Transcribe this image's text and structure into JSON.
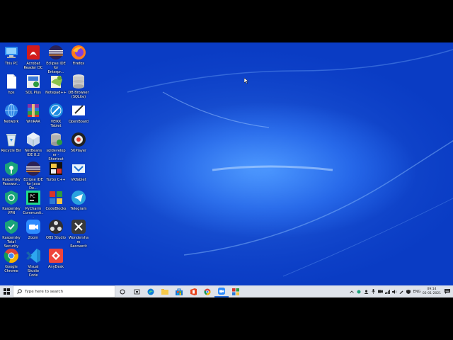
{
  "desktop": {
    "icons": [
      {
        "label": "This PC",
        "icon": "computer-icon"
      },
      {
        "label": "Acrobat Reader DC",
        "icon": "acrobat-icon"
      },
      {
        "label": "Eclipse IDE for Enterpr...",
        "icon": "eclipse-icon"
      },
      {
        "label": "Firefox",
        "icon": "firefox-icon"
      },
      {
        "label": "hps",
        "icon": "document-icon"
      },
      {
        "label": "SQL Plus",
        "icon": "sqlplus-icon"
      },
      {
        "label": "Notepad++",
        "icon": "notepadpp-icon"
      },
      {
        "label": "DB Browser (SQLite)",
        "icon": "database-icon"
      },
      {
        "label": "Network",
        "icon": "network-icon"
      },
      {
        "label": "WinRAR",
        "icon": "winrar-icon"
      },
      {
        "label": "VEIKK Tablet",
        "icon": "veikk-icon"
      },
      {
        "label": "OpenBoard",
        "icon": "openboard-icon"
      },
      {
        "label": "Recycle Bin",
        "icon": "recycle-bin-icon"
      },
      {
        "label": "NetBeans IDE 8.2",
        "icon": "netbeans-icon"
      },
      {
        "label": "sqldeveloper - Shortcut",
        "icon": "sqldeveloper-icon"
      },
      {
        "label": "5KPlayer",
        "icon": "5kplayer-icon"
      },
      {
        "label": "Kaspersky Passwor...",
        "icon": "kaspersky-password-icon"
      },
      {
        "label": "Eclipse IDE for Java De...",
        "icon": "eclipse-java-icon"
      },
      {
        "label": "Turbo C++",
        "icon": "turbocpp-icon"
      },
      {
        "label": "VKTablet",
        "icon": "vktablet-icon"
      },
      {
        "label": "Kaspersky VPN",
        "icon": "kaspersky-vpn-icon"
      },
      {
        "label": "PyCharm Communit...",
        "icon": "pycharm-icon"
      },
      {
        "label": "CodeBlocks",
        "icon": "codeblocks-icon"
      },
      {
        "label": "Telegram",
        "icon": "telegram-icon"
      },
      {
        "label": "Kaspersky Total Security",
        "icon": "kaspersky-total-icon"
      },
      {
        "label": "Zoom",
        "icon": "zoom-icon"
      },
      {
        "label": "OBS Studio",
        "icon": "obs-icon"
      },
      {
        "label": "Wondershare Recoverit",
        "icon": "recoverit-icon"
      },
      {
        "label": "Google Chrome",
        "icon": "chrome-icon"
      },
      {
        "label": "Visual Studio Code",
        "icon": "vscode-icon"
      },
      {
        "label": "AnyDesk",
        "icon": "anydesk-icon"
      }
    ]
  },
  "taskbar": {
    "search_placeholder": "Type here to search",
    "clock_time": "09:14",
    "clock_date": "02-01-2021",
    "language": "ENG"
  },
  "colors": {
    "desktop_blue": "#1657e0",
    "taskbar": "#dfe3ea",
    "accent": "#2a6cd6"
  }
}
